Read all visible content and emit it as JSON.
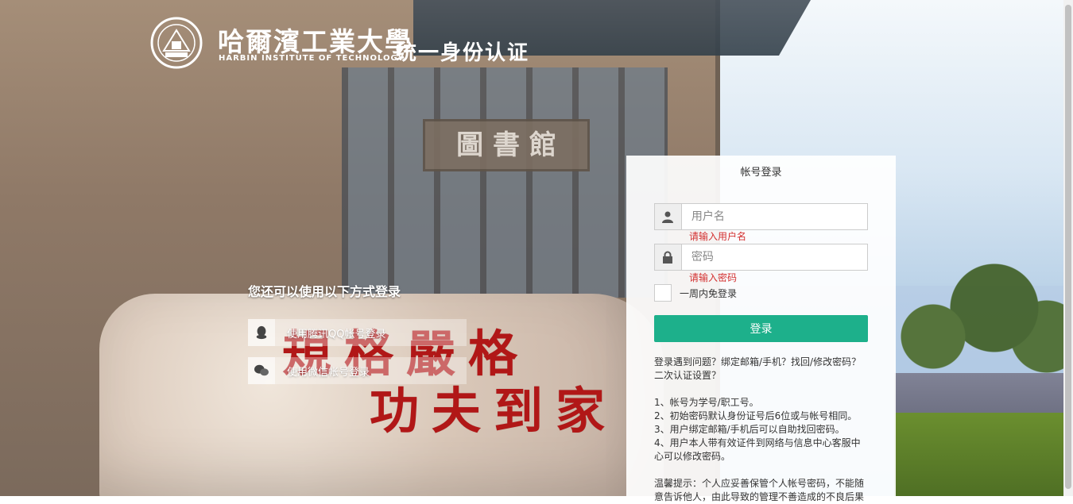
{
  "header": {
    "school_cn": "哈爾濱工業大學",
    "school_en": "HARBIN INSTITUTE OF TECHNOLOGY",
    "system_name": "统一身份认证"
  },
  "background": {
    "stone_line1": "規格嚴格",
    "stone_line2": "功夫到家",
    "building_sign": "圖 書 館"
  },
  "alternate_login": {
    "title": "您还可以使用以下方式登录",
    "qq_label": "使用腾讯QQ帐号登录",
    "wechat_label": "使用微信帐号登录"
  },
  "login_panel": {
    "title": "帐号登录",
    "username_placeholder": "用户名",
    "username_error": "请输入用户名",
    "password_placeholder": "密码",
    "password_error": "请输入密码",
    "remember_label": "一周内免登录",
    "submit_label": "登录",
    "help_line1": "登录遇到问题？绑定邮箱/手机？找回/修改密码？二次认证设置？",
    "rules": [
      "1、帐号为学号/职工号。",
      "2、初始密码默认身份证号后6位或与帐号相同。",
      "3、用户绑定邮箱/手机后可以自助找回密码。",
      "4、用户本人带有效证件到网络与信息中心客服中心可以修改密码。"
    ],
    "tip": "温馨提示：个人应妥善保管个人帐号密码，不能随意告诉他人，由此导致的管理不善造成的不良后果"
  },
  "colors": {
    "accent": "#1db08b",
    "error": "#d32f2f"
  }
}
